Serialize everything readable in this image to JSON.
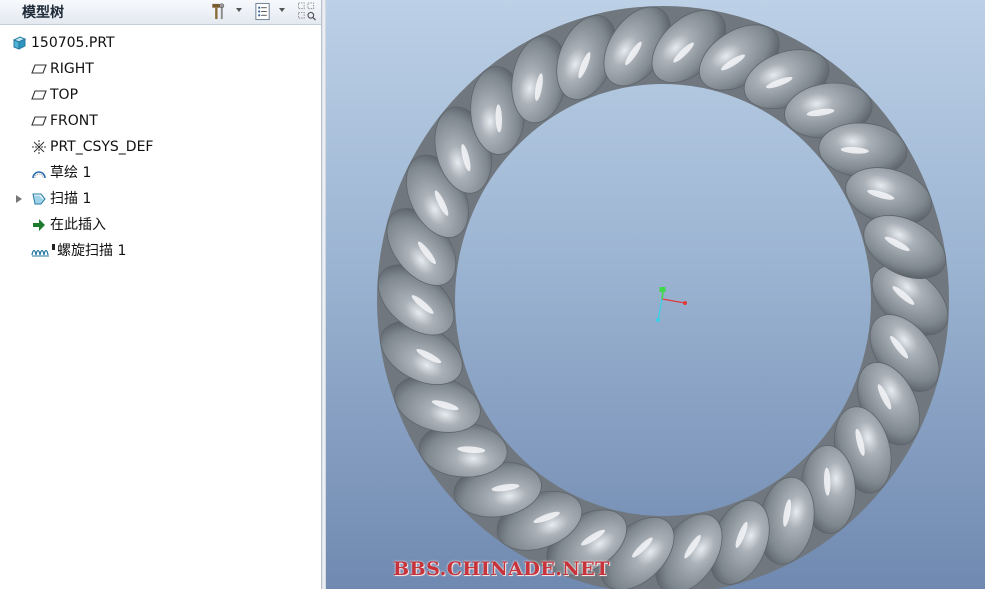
{
  "tree_panel": {
    "title": "模型树",
    "tools": [
      {
        "icon": "hammer-settings-icon"
      },
      {
        "icon": "tree-columns-icon"
      },
      {
        "icon": "tree-filter-icon"
      }
    ],
    "items": [
      {
        "label": "150705.PRT",
        "icon": "part-icon",
        "level": 0,
        "expandable": false
      },
      {
        "label": "RIGHT",
        "icon": "datum-plane-icon",
        "level": 1,
        "expandable": false
      },
      {
        "label": "TOP",
        "icon": "datum-plane-icon",
        "level": 1,
        "expandable": false
      },
      {
        "label": "FRONT",
        "icon": "datum-plane-icon",
        "level": 1,
        "expandable": false
      },
      {
        "label": "PRT_CSYS_DEF",
        "icon": "coordinate-system-icon",
        "level": 1,
        "expandable": false
      },
      {
        "label": "草绘 1",
        "icon": "sketch-icon",
        "level": 1,
        "expandable": false
      },
      {
        "label": "扫描 1",
        "icon": "sweep-icon",
        "level": 1,
        "expandable": true
      },
      {
        "label": "在此插入",
        "icon": "insert-here-arrow-icon",
        "level": 1,
        "expandable": false
      },
      {
        "label": "螺旋扫描 1",
        "icon": "helical-sweep-icon",
        "level": 1,
        "expandable": false
      }
    ]
  },
  "viewport": {
    "model": "twisted-rope-ring",
    "colors": {
      "background_top": "#bcd0e6",
      "background_bottom": "#7089b0",
      "model": "#8f969d",
      "axis_x": "#e23a3a",
      "axis_y": "#3fd84a",
      "axis_z": "#3ad0e6"
    }
  },
  "watermark": "BBS.CHINADE.NET"
}
